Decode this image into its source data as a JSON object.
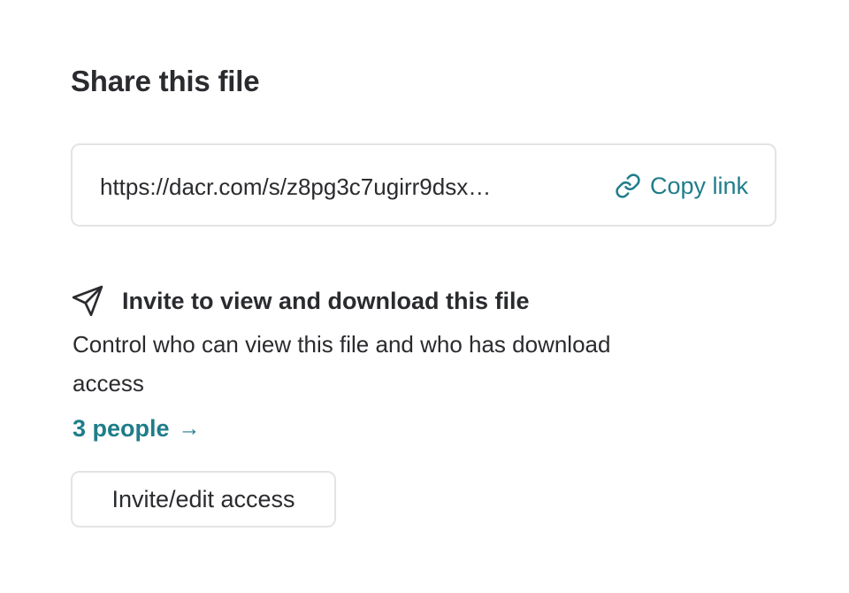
{
  "share": {
    "title": "Share this file",
    "link_url": "https://dacr.com/s/z8pg3c7ugirr9dsx…",
    "copy_label": "Copy link"
  },
  "invite": {
    "title": "Invite to view and download this file",
    "description": "Control who can view this file and who has download access",
    "people_link": "3 people",
    "people_arrow": "→",
    "button_label": "Invite/edit access"
  },
  "icons": {
    "copy": "link-icon",
    "invite": "send-icon",
    "people": "arrow-right-icon"
  },
  "colors": {
    "accent": "#1f7d8a",
    "text": "#2a2b2e",
    "border": "#e4e4e6"
  }
}
